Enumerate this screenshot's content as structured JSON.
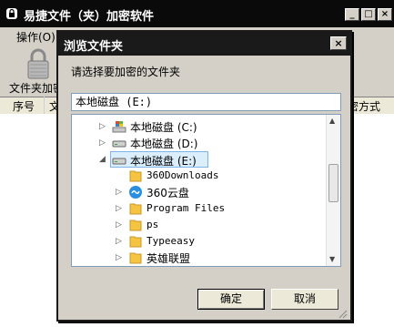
{
  "app": {
    "title": "易捷文件（夹）加密软件",
    "menu_ops": "操作(O)",
    "lock_label": "文件夹加密",
    "col_seq": "序号",
    "col_file": "文",
    "col_method": "密方式"
  },
  "dialog": {
    "title": "浏览文件夹",
    "prompt": "请选择要加密的文件夹",
    "path": "本地磁盘 (E:)",
    "ok_label": "确定",
    "cancel_label": "取消",
    "close_glyph": "×"
  },
  "tree": [
    {
      "label": "本地磁盘 (C:)",
      "icon": "windows-drive-icon",
      "expanded": false
    },
    {
      "label": "本地磁盘 (D:)",
      "icon": "drive-icon",
      "expanded": false
    },
    {
      "label": "本地磁盘 (E:)",
      "icon": "drive-icon",
      "expanded": true,
      "selected": true
    },
    {
      "label": "360Downloads",
      "icon": "folder-icon"
    },
    {
      "label": "360云盘",
      "icon": "cloud-drive-icon"
    },
    {
      "label": "Program Files",
      "icon": "folder-icon"
    },
    {
      "label": "ps",
      "icon": "folder-icon"
    },
    {
      "label": "Typeeasy",
      "icon": "folder-icon"
    },
    {
      "label": "英雄联盟",
      "icon": "folder-icon"
    }
  ],
  "colors": {
    "titlebar": "#1a1a1a",
    "dialog_bg": "#d4d0c8",
    "selection": "#dbeefc",
    "folder": "#f5c542"
  }
}
